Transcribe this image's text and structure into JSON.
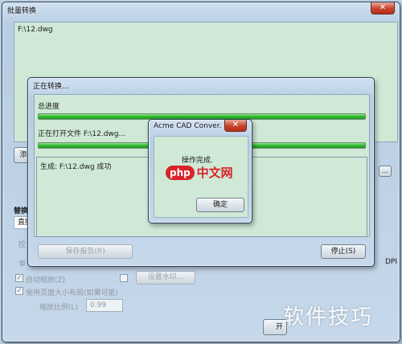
{
  "main_window": {
    "title": "批量转换",
    "file_entry": "F:\\12.dwg",
    "add_button": "添",
    "section_label": "替换",
    "dropdown_value": "直接",
    "muted_label_1": "控",
    "muted_label_2": "单",
    "checkbox_auto": "自动缩放(Z)",
    "checkbox_auto_checked": true,
    "watermark_button": "设置水印...",
    "checkbox_layout": "使用页面大小布局(如果可能)",
    "checkbox_layout_checked": true,
    "scale_label": "缩放比例(L)",
    "scale_value": "0.99",
    "dpi_suffix": "DPI",
    "bottom_button_fragment": "开",
    "small_button_fragment": "..."
  },
  "progress_window": {
    "title": "正在转换...",
    "total_progress_label": "总进度",
    "total_progress_fraction": 1.0,
    "current_file_label": "正在打开文件 F:\\12.dwg...",
    "current_file_fraction": 1.0,
    "log_text": "生成: F:\\12.dwg 成功",
    "save_report_button": "保存报告(R)",
    "stop_button": "停止(S)"
  },
  "message_box": {
    "title": "Acme CAD Conver...",
    "close_glyph": "✕",
    "message": "操作完成.",
    "ok_button": "确定"
  },
  "watermarks": {
    "php_logo_prefix": "php",
    "php_logo_text": "中文网",
    "corner_text": "软件技巧"
  }
}
